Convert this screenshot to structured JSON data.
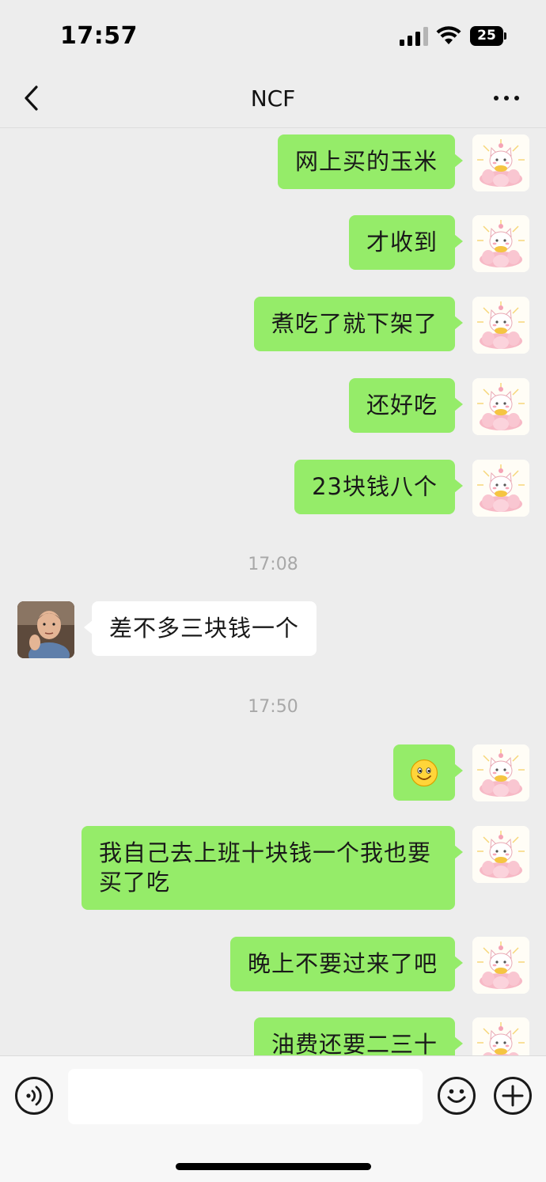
{
  "status_bar": {
    "time": "17:57",
    "battery": "25"
  },
  "nav": {
    "title": "NCF"
  },
  "messages": [
    {
      "side": "me",
      "text": "网上买的玉米"
    },
    {
      "side": "me",
      "text": "才收到"
    },
    {
      "side": "me",
      "text": "煮吃了就下架了"
    },
    {
      "side": "me",
      "text": "还好吃"
    },
    {
      "side": "me",
      "text": "23块钱八个"
    },
    {
      "type": "time",
      "text": "17:08"
    },
    {
      "side": "them",
      "text": "差不多三块钱一个"
    },
    {
      "type": "time",
      "text": "17:50"
    },
    {
      "side": "me",
      "emoji": "smile-emoji"
    },
    {
      "side": "me",
      "text": "我自己去上班十块钱一个我也要\n买了吃"
    },
    {
      "side": "me",
      "text": "晚上不要过来了吧"
    },
    {
      "side": "me",
      "text": "油费还要二三十"
    }
  ],
  "input": {
    "placeholder": ""
  },
  "icons": {
    "back": "chevron-left-icon",
    "more": "more-dots-icon",
    "voice": "voice-icon",
    "emoji": "emoji-icon",
    "plus": "plus-icon"
  },
  "colors": {
    "my_bubble": "#95ec69",
    "their_bubble": "#ffffff",
    "background": "#ededed"
  }
}
